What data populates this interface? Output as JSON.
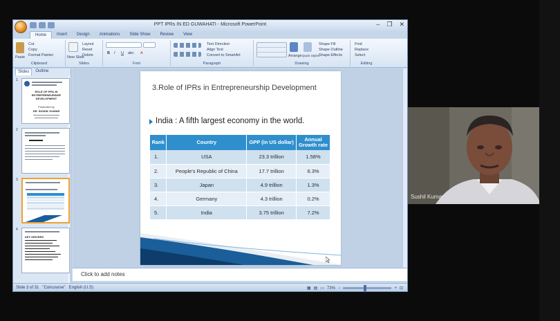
{
  "window": {
    "title": "PPT IPRs IN ED GUWAHATI - Microsoft PowerPoint",
    "controls": [
      "–",
      "❐",
      "✕"
    ]
  },
  "ribbon_tabs": [
    "Home",
    "Insert",
    "Design",
    "Animations",
    "Slide Show",
    "Review",
    "View"
  ],
  "ribbon": {
    "clipboard": {
      "label": "Clipboard",
      "paste": "Paste",
      "cut": "Cut",
      "copy": "Copy",
      "format_painter": "Format Painter"
    },
    "slides": {
      "label": "Slides",
      "new_slide": "New Slide",
      "layout": "Layout",
      "reset": "Reset",
      "delete": "Delete"
    },
    "font": {
      "label": "Font"
    },
    "paragraph": {
      "label": "Paragraph",
      "text_direction": "Text Direction",
      "align_text": "Align Text",
      "convert_smartart": "Convert to SmartArt"
    },
    "drawing": {
      "label": "Drawing",
      "arrange": "Arrange",
      "quick_styles": "Quick Styles",
      "shape_fill": "Shape Fill",
      "shape_outline": "Shape Outline",
      "shape_effects": "Shape Effects"
    },
    "editing": {
      "label": "Editing",
      "find": "Find",
      "replace": "Replace",
      "select": "Select"
    }
  },
  "panel": {
    "tabs": [
      "Slides",
      "Outline"
    ],
    "thumb1_title": "ROLE OF IPRs IN ENTREPRENEURSHIP DEVELOPMENT",
    "thumb1_presenter": "Presented by",
    "thumb1_name": "DR. SUSHIL KUMAR",
    "thumb4_line": "KEY DRIVERS"
  },
  "slide": {
    "title": "3.Role of IPRs in Entrepreneurship Development",
    "bullet": "India : A fifth largest economy in the world.",
    "table": {
      "headers": [
        "Rank",
        "Country",
        "GPP (in US dollar)",
        "Annual Growth rate"
      ],
      "rows": [
        [
          "1.",
          "USA",
          "23.3 trillion",
          "1.58%"
        ],
        [
          "2.",
          "People's Republic of China",
          "17.7 trillion",
          "6.3%"
        ],
        [
          "3.",
          "Japan",
          "4.9 trillion",
          "1.3%"
        ],
        [
          "4.",
          "Germany",
          "4.3 trillion",
          "0.2%"
        ],
        [
          "5.",
          "India",
          "3.75 trillion",
          "7.2%"
        ]
      ]
    }
  },
  "notes": {
    "placeholder": "Click to add notes"
  },
  "status": {
    "slide_info": "Slide 3 of 31",
    "theme": "\"Concourse\"",
    "language": "English (U.S)",
    "zoom": "73%"
  },
  "webcam": {
    "name": "Sushil Kumar"
  },
  "colors": {
    "table_header": "#2f8fcd",
    "row_dark": "#cfe0ef",
    "row_light": "#e6eff7",
    "bullet": "#1e7cb8"
  }
}
